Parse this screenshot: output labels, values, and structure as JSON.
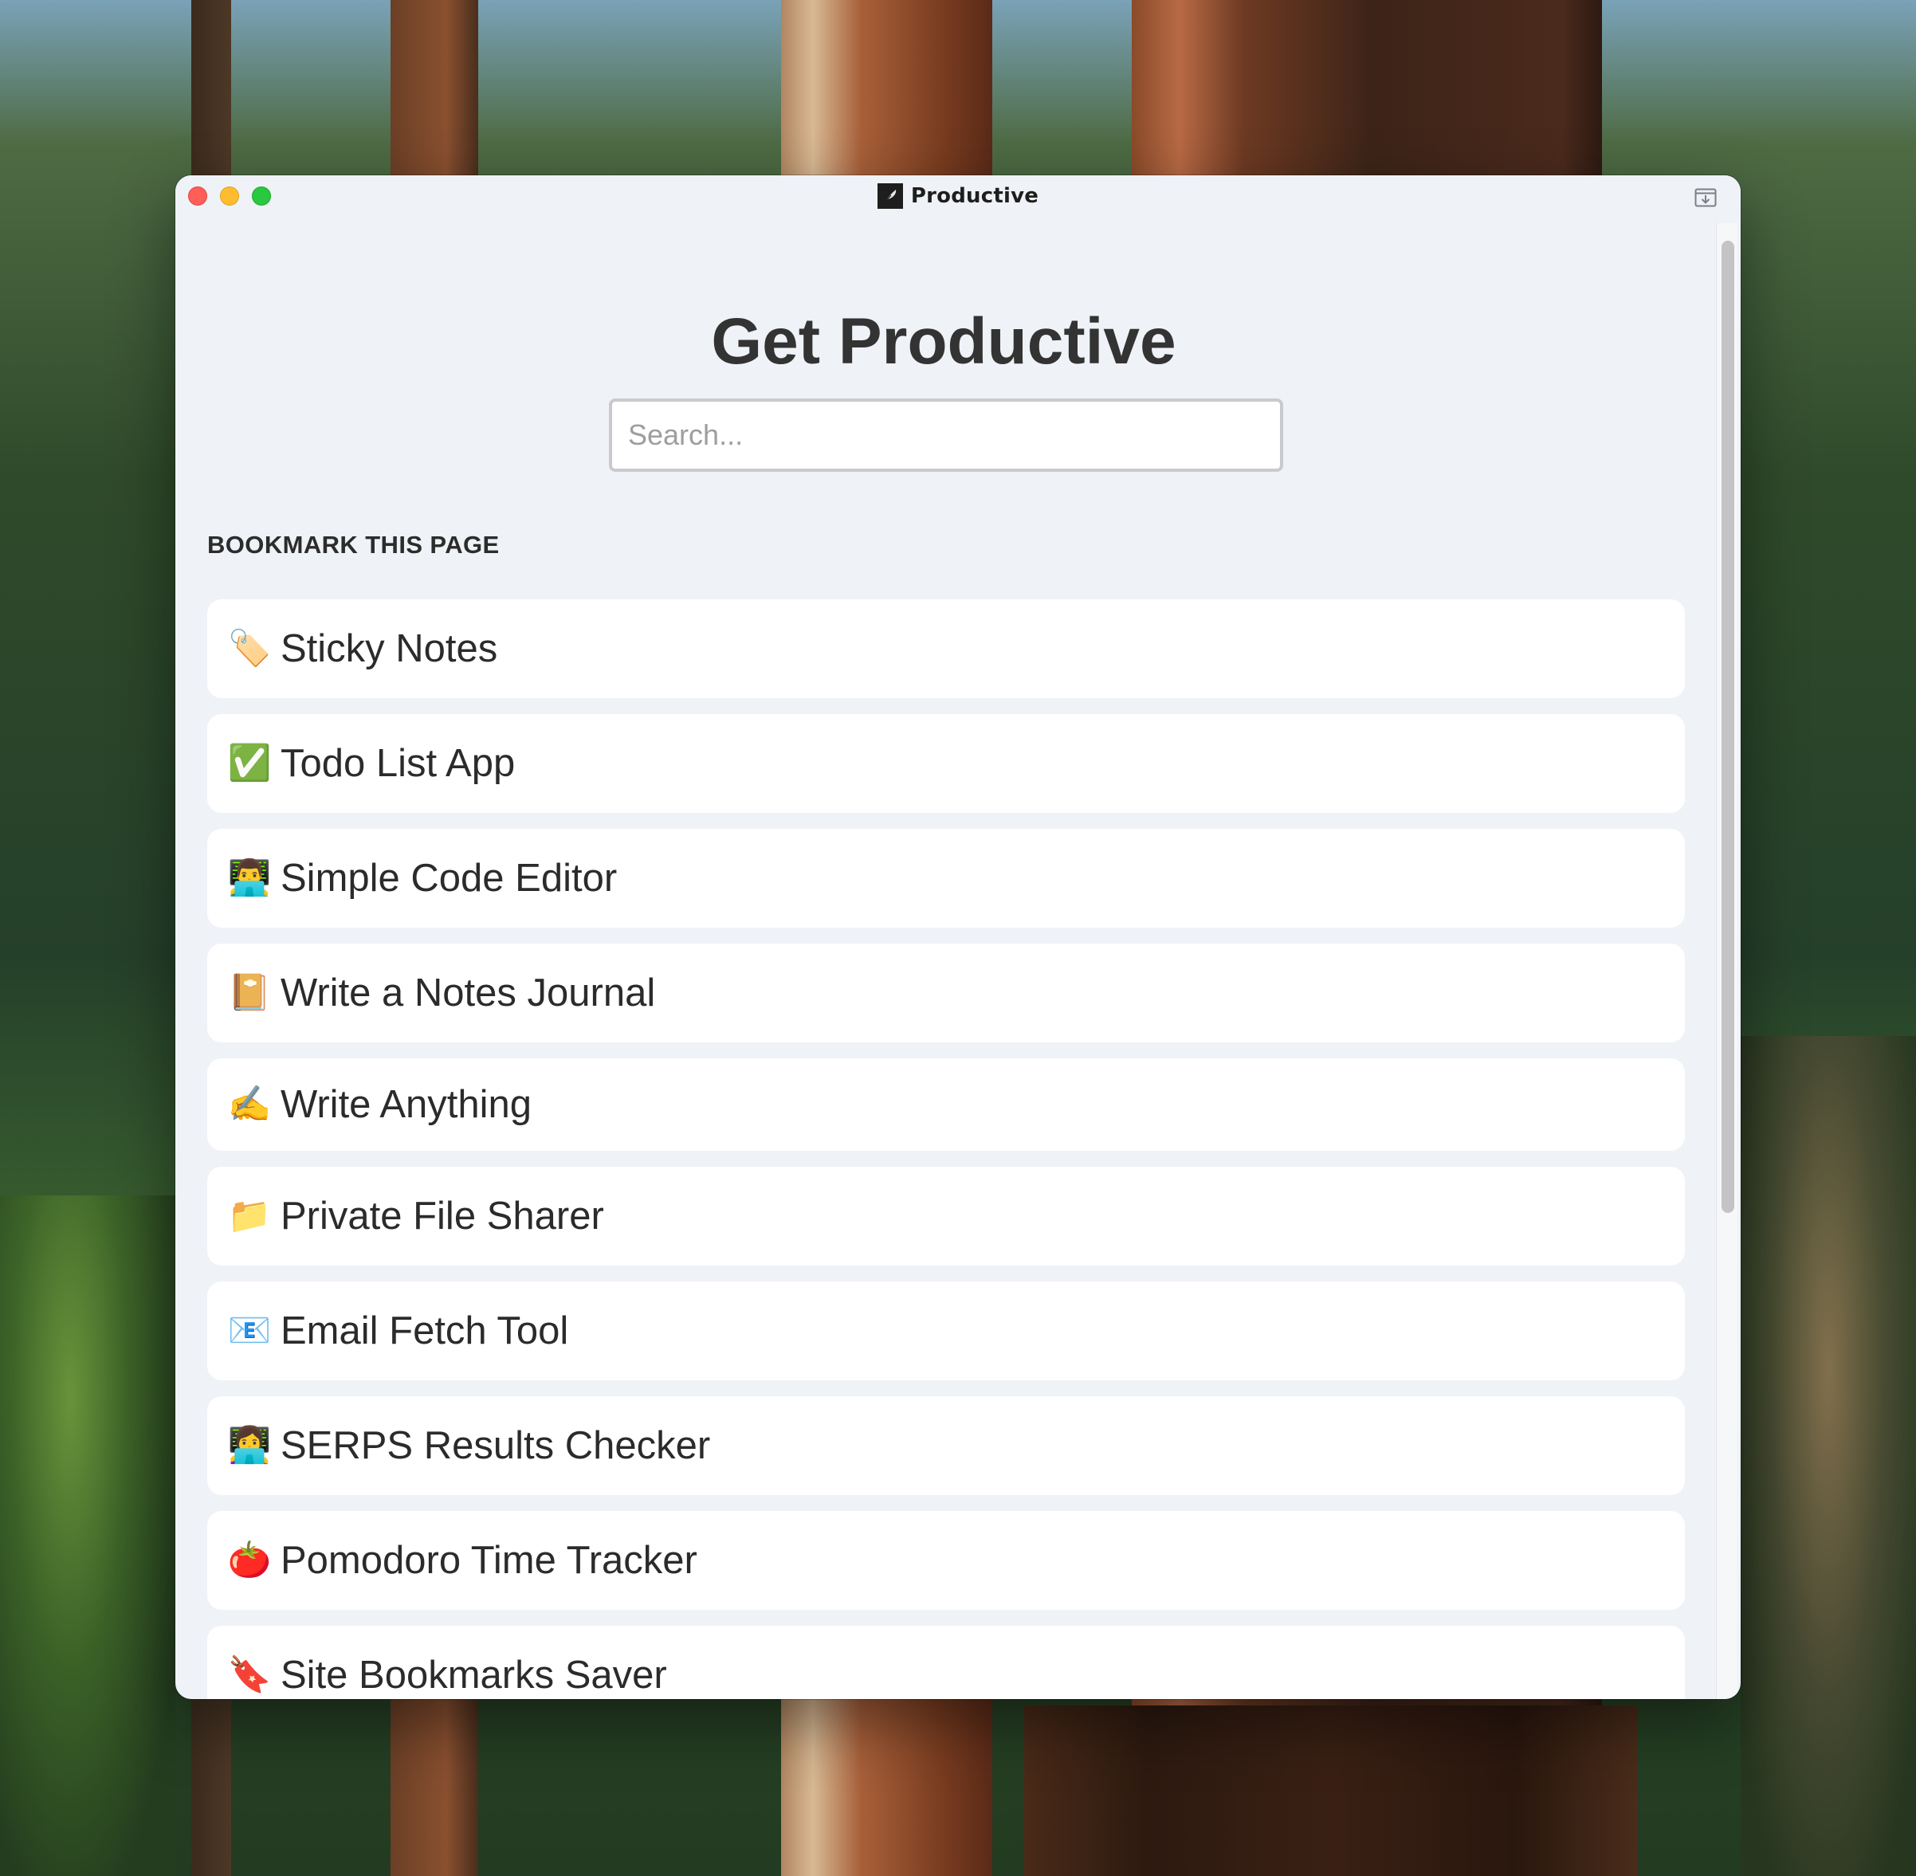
{
  "window": {
    "title": "Productive",
    "controls": {
      "close": "close-window",
      "minimize": "minimize-window",
      "maximize": "maximize-window"
    },
    "titlebar_action_icon": "download-to-window-icon"
  },
  "page": {
    "heading": "Get Productive",
    "search": {
      "placeholder": "Search...",
      "value": ""
    },
    "section_label": "BOOKMARK THIS PAGE",
    "items": [
      {
        "icon": "tag-icon",
        "emoji": "🏷️",
        "label": "Sticky Notes"
      },
      {
        "icon": "check-mark-button-icon",
        "emoji": "✅",
        "label": "Todo List App"
      },
      {
        "icon": "man-technologist-icon",
        "emoji": "👨‍💻",
        "label": "Simple Code Editor"
      },
      {
        "icon": "notebook-icon",
        "emoji": "📔",
        "label": "Write a Notes Journal"
      },
      {
        "icon": "writing-hand-icon",
        "emoji": "✍️",
        "label": "Write Anything"
      },
      {
        "icon": "folder-icon",
        "emoji": "📁",
        "label": "Private File Sharer"
      },
      {
        "icon": "email-icon",
        "emoji": "📧",
        "label": "Email Fetch Tool"
      },
      {
        "icon": "woman-technologist-icon",
        "emoji": "👩‍💻",
        "label": "SERPS Results Checker"
      },
      {
        "icon": "tomato-icon",
        "emoji": "🍅",
        "label": "Pomodoro Time Tracker"
      },
      {
        "icon": "bookmark-tag-icon",
        "emoji": "🔖",
        "label": "Site Bookmarks Saver"
      }
    ]
  },
  "colors": {
    "window_bg": "#eff2f7",
    "card_bg": "#ffffff",
    "text": "#2b2b2b",
    "close": "#fe5f57",
    "minimize": "#febc2e",
    "maximize": "#28c840",
    "scroll_thumb": "#c4c4c6"
  }
}
